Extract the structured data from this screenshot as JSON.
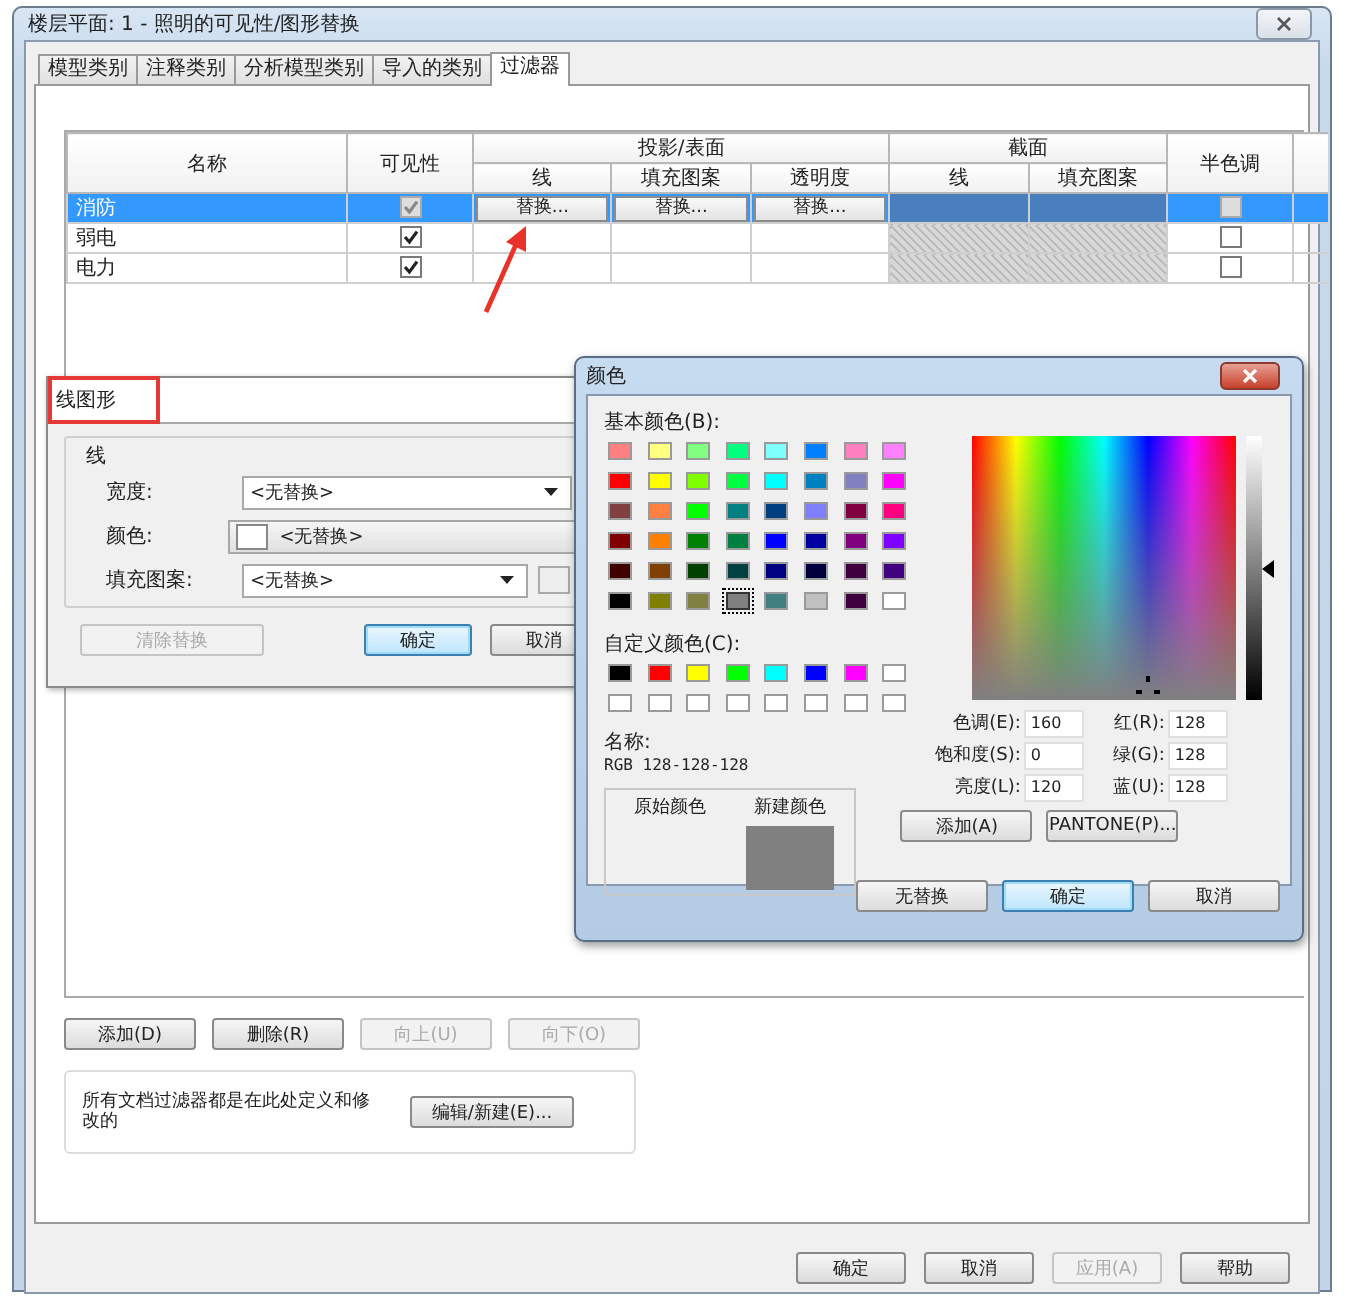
{
  "window": {
    "title": "楼层平面: 1 - 照明的可见性/图形替换"
  },
  "tabs": [
    {
      "label": "模型类别",
      "selected": false
    },
    {
      "label": "注释类别",
      "selected": false
    },
    {
      "label": "分析模型类别",
      "selected": false
    },
    {
      "label": "导入的类别",
      "selected": false
    },
    {
      "label": "过滤器",
      "selected": true
    }
  ],
  "filter_table": {
    "header": {
      "name": "名称",
      "visibility": "可见性",
      "projection": {
        "label": "投影/表面",
        "columns": [
          "线",
          "填充图案",
          "透明度"
        ]
      },
      "cut": {
        "label": "截面",
        "columns": [
          "线",
          "填充图案"
        ]
      },
      "halftone": "半色调"
    },
    "rows": [
      {
        "name": "消防",
        "selected": true,
        "visible": true,
        "overrides": [
          "替换...",
          "替换...",
          "替换..."
        ],
        "halftone": false
      },
      {
        "name": "弱电",
        "selected": false,
        "visible": true,
        "halftone": false
      },
      {
        "name": "电力",
        "selected": false,
        "visible": true,
        "halftone": false
      }
    ]
  },
  "filter_buttons": [
    {
      "label": "添加(D)",
      "disabled": false
    },
    {
      "label": "删除(R)",
      "disabled": false
    },
    {
      "label": "向上(U)",
      "disabled": true
    },
    {
      "label": "向下(O)",
      "disabled": true
    }
  ],
  "info": {
    "text": "所有文档过滤器都是在此处定义和修改的",
    "button": "编辑/新建(E)..."
  },
  "dialog_buttons": [
    {
      "label": "确定",
      "disabled": false
    },
    {
      "label": "取消",
      "disabled": false
    },
    {
      "label": "应用(A)",
      "disabled": true
    },
    {
      "label": "帮助",
      "disabled": false
    }
  ],
  "line_dialog": {
    "title": "线图形",
    "group": "线",
    "fields": [
      {
        "kind": "dropdown",
        "label": "宽度:",
        "value": "<无替换>"
      },
      {
        "kind": "color",
        "label": "颜色:",
        "value": "<无替换>"
      },
      {
        "kind": "pattern",
        "label": "填充图案:",
        "value": "<无替换>"
      }
    ],
    "buttons": [
      {
        "label": "清除替换",
        "disabled": true,
        "focused": false
      },
      {
        "label": "确定",
        "disabled": false,
        "focused": true
      },
      {
        "label": "取消",
        "disabled": false,
        "focused": false
      }
    ]
  },
  "color_dialog": {
    "title": "颜色",
    "basic_label": "基本颜色(B):",
    "basic_colors": [
      {
        "color": "#ff8080",
        "selected": false
      },
      {
        "color": "#ffff80",
        "selected": false
      },
      {
        "color": "#80ff80",
        "selected": false
      },
      {
        "color": "#00ff80",
        "selected": false
      },
      {
        "color": "#80ffff",
        "selected": false
      },
      {
        "color": "#0080ff",
        "selected": false
      },
      {
        "color": "#ff80c0",
        "selected": false
      },
      {
        "color": "#ff80ff",
        "selected": false
      },
      {
        "color": "#ff0000",
        "selected": false
      },
      {
        "color": "#ffff00",
        "selected": false
      },
      {
        "color": "#80ff00",
        "selected": false
      },
      {
        "color": "#00ff40",
        "selected": false
      },
      {
        "color": "#00ffff",
        "selected": false
      },
      {
        "color": "#0080c0",
        "selected": false
      },
      {
        "color": "#8080c0",
        "selected": false
      },
      {
        "color": "#ff00ff",
        "selected": false
      },
      {
        "color": "#804040",
        "selected": false
      },
      {
        "color": "#ff8040",
        "selected": false
      },
      {
        "color": "#00ff00",
        "selected": false
      },
      {
        "color": "#008080",
        "selected": false
      },
      {
        "color": "#004080",
        "selected": false
      },
      {
        "color": "#8080ff",
        "selected": false
      },
      {
        "color": "#800040",
        "selected": false
      },
      {
        "color": "#ff0080",
        "selected": false
      },
      {
        "color": "#800000",
        "selected": false
      },
      {
        "color": "#ff8000",
        "selected": false
      },
      {
        "color": "#008000",
        "selected": false
      },
      {
        "color": "#008040",
        "selected": false
      },
      {
        "color": "#0000ff",
        "selected": false
      },
      {
        "color": "#0000a0",
        "selected": false
      },
      {
        "color": "#800080",
        "selected": false
      },
      {
        "color": "#8000ff",
        "selected": false
      },
      {
        "color": "#400000",
        "selected": false
      },
      {
        "color": "#804000",
        "selected": false
      },
      {
        "color": "#004000",
        "selected": false
      },
      {
        "color": "#004040",
        "selected": false
      },
      {
        "color": "#000080",
        "selected": false
      },
      {
        "color": "#000040",
        "selected": false
      },
      {
        "color": "#400040",
        "selected": false
      },
      {
        "color": "#400080",
        "selected": false
      },
      {
        "color": "#000000",
        "selected": false
      },
      {
        "color": "#808000",
        "selected": false
      },
      {
        "color": "#808040",
        "selected": false
      },
      {
        "color": "#808080",
        "selected": true
      },
      {
        "color": "#408080",
        "selected": false
      },
      {
        "color": "#c0c0c0",
        "selected": false
      },
      {
        "color": "#400040",
        "selected": false
      },
      {
        "color": "#ffffff",
        "selected": false
      }
    ],
    "custom_label": "自定义颜色(C):",
    "custom_colors": [
      {
        "color": "#000000"
      },
      {
        "color": "#ff0000"
      },
      {
        "color": "#ffff00"
      },
      {
        "color": "#00ff00"
      },
      {
        "color": "#00ffff"
      },
      {
        "color": "#0000ff"
      },
      {
        "color": "#ff00ff"
      },
      {
        "color": "#ffffff"
      },
      {
        "color": "#ffffff"
      },
      {
        "color": "#ffffff"
      },
      {
        "color": "#ffffff"
      },
      {
        "color": "#ffffff"
      },
      {
        "color": "#ffffff"
      },
      {
        "color": "#ffffff"
      },
      {
        "color": "#ffffff"
      },
      {
        "color": "#ffffff"
      }
    ],
    "name_label": "名称:",
    "name_value": "RGB 128-128-128",
    "original_label": "原始颜色",
    "new_label": "新建颜色",
    "luminance": {
      "level": 0.5
    },
    "hsl_fields": [
      {
        "label": "色调(E):",
        "value": "160"
      },
      {
        "label": "饱和度(S):",
        "value": "0"
      },
      {
        "label": "亮度(L):",
        "value": "120"
      }
    ],
    "rgb_fields": [
      {
        "label": "红(R):",
        "value": "128"
      },
      {
        "label": "绿(G):",
        "value": "128"
      },
      {
        "label": "蓝(U):",
        "value": "128"
      }
    ],
    "side_buttons": [
      {
        "label": "添加(A)"
      },
      {
        "label": "PANTONE(P)..."
      }
    ],
    "buttons": [
      {
        "label": "无替换",
        "focused": false
      },
      {
        "label": "确定",
        "focused": true
      },
      {
        "label": "取消",
        "focused": false
      }
    ]
  }
}
